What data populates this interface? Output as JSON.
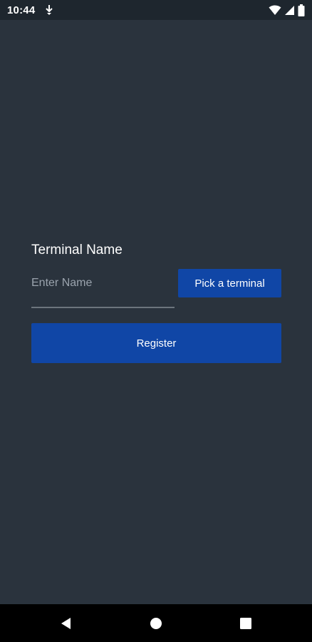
{
  "status_bar": {
    "time": "10:44",
    "icons": [
      "download-icon",
      "wifi-icon",
      "signal-icon",
      "battery-icon"
    ]
  },
  "form": {
    "label": "Terminal Name",
    "name_input": {
      "value": "",
      "placeholder": "Enter Name"
    },
    "pick_button_label": "Pick a terminal",
    "register_button_label": "Register"
  },
  "nav_bar": {
    "icons": [
      "back-icon",
      "home-icon",
      "recent-apps-icon"
    ]
  },
  "colors": {
    "background": "#2a333d",
    "status_bar": "#1e262e",
    "accent": "#1046a6",
    "nav_bar": "#000000",
    "input_underline": "#6c757d",
    "placeholder": "#9aa3ad"
  }
}
